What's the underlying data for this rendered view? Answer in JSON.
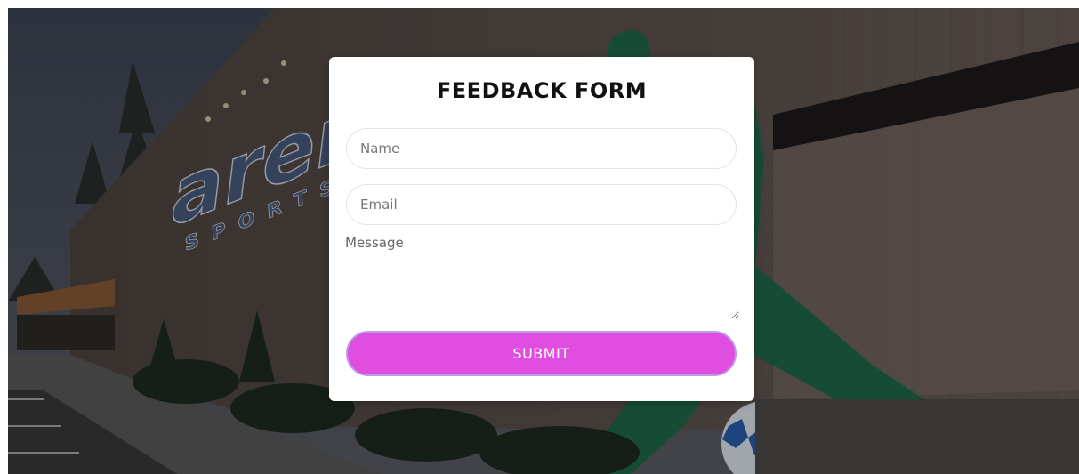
{
  "background": {
    "building_logo": "arena",
    "building_logo_sub": "SPORTS"
  },
  "form": {
    "title": "FEEDBACK FORM",
    "name_placeholder": "Name",
    "email_placeholder": "Email",
    "message_placeholder": "Message",
    "submit_label": "SUBMIT"
  },
  "colors": {
    "submit_bg": "#e04ee0",
    "submit_border": "#b89ae6",
    "card_bg": "#ffffff"
  }
}
